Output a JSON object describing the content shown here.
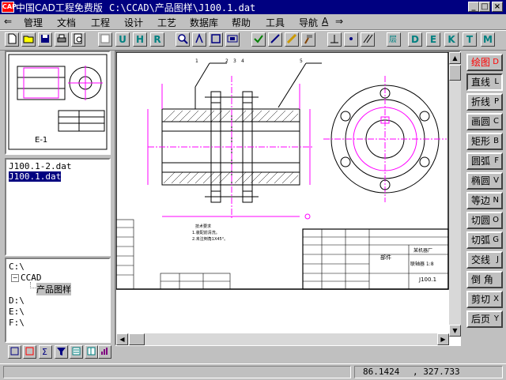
{
  "window": {
    "logo": "CAP",
    "app_title": "中国CAD工程免费版",
    "path": "C:\\CCAD\\产品图样\\J100.1.dat",
    "btn_minimize": "_",
    "btn_maximize": "□",
    "btn_close": "×"
  },
  "menu": {
    "back": "⇐",
    "items": [
      "管理",
      "文档",
      "工程",
      "设计",
      "工艺",
      "数据库",
      "帮助",
      "工具",
      "导航"
    ],
    "nav_key": "A",
    "forward": "⇒"
  },
  "toolbar": {
    "letters_left": [
      "U",
      "H",
      "R"
    ],
    "letters_right": [
      "D",
      "E",
      "K",
      "T",
      "M"
    ]
  },
  "thumbnail": {
    "caption": "E-1"
  },
  "files": {
    "items": [
      "J100.1-2.dat",
      "J100.1.dat"
    ],
    "selected_index": 1
  },
  "dirs": {
    "root": "C:\\",
    "ccad": "CCAD",
    "sub": "产品图样",
    "drives": [
      "D:\\",
      "E:\\",
      "F:\\"
    ]
  },
  "drawing": {
    "title_block": {
      "name": "部件",
      "code": "J100.1",
      "company": "某机器厂",
      "scale_label": "联轴器 1:8"
    },
    "notes_title": "技术要求",
    "note1": "1.装配前清洗。",
    "note2": "2.未注倒角1X45°。",
    "balloons": [
      "1",
      "2",
      "3",
      "4",
      "5"
    ]
  },
  "commands": [
    {
      "label": "绘图",
      "key": "D",
      "active": true
    },
    {
      "label": "直线",
      "key": "L"
    },
    {
      "label": "折线",
      "key": "P"
    },
    {
      "label": "画圆",
      "key": "C"
    },
    {
      "label": "矩形",
      "key": "B"
    },
    {
      "label": "圆弧",
      "key": "F"
    },
    {
      "label": "椭圆",
      "key": "V"
    },
    {
      "label": "等边",
      "key": "N"
    },
    {
      "label": "切圆",
      "key": "O"
    },
    {
      "label": "切弧",
      "key": "G"
    },
    {
      "label": "交线",
      "key": "J"
    },
    {
      "label": "倒  角",
      "key": ""
    },
    {
      "label": "剪切",
      "key": "X"
    },
    {
      "label": "后页",
      "key": "Y"
    }
  ],
  "status": {
    "x": "86.1424",
    "y": ", 327.733"
  },
  "colors": {
    "title_bg": "#000080",
    "drawing_line": "#ff00ff",
    "accent_red": "#ff0000",
    "toolbar_letter": "#008080"
  }
}
